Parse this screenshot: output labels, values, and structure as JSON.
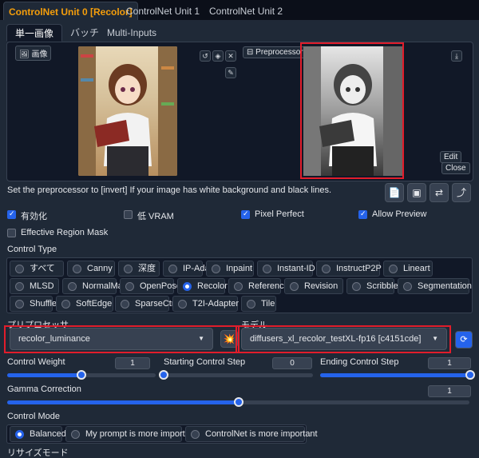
{
  "tabs": [
    "ControlNet Unit 0 [Recolor]",
    "ControlNet Unit 1",
    "ControlNet Unit 2"
  ],
  "subtabs": [
    "単一画像",
    "バッチ",
    "Multi-Inputs"
  ],
  "image_label": "画像",
  "preview_label": "Preprocessor Preview",
  "edit_label": "Edit",
  "close_label": "Close",
  "hint_text": "Set the preprocessor to [invert] If your image has white background and black lines.",
  "checks": {
    "enable": "有効化",
    "lowvram": "低 VRAM",
    "pixel_perfect": "Pixel Perfect",
    "allow_preview": "Allow Preview",
    "region_mask": "Effective Region Mask"
  },
  "control_type_label": "Control Type",
  "control_types": [
    "すべて",
    "Canny",
    "深度",
    "IP-Adapter",
    "Inpaint",
    "Instant-ID",
    "InstructP2P",
    "Lineart",
    "MLSD",
    "NormalMap",
    "OpenPose",
    "Recolor",
    "Reference",
    "Revision",
    "Scribble",
    "Segmentation",
    "Shuffle",
    "SoftEdge",
    "SparseCtrl",
    "T2I-Adapter",
    "Tile"
  ],
  "selected_control_type": "Recolor",
  "preprocessor_label": "プリプロセッサ",
  "preprocessor_value": "recolor_luminance",
  "model_label": "モデル",
  "model_value": "diffusers_xl_recolor_testXL-fp16 [c4151cde]",
  "control_weight_label": "Control Weight",
  "control_weight_value": "1",
  "control_weight": 1,
  "start_step_label": "Starting Control Step",
  "start_step_value": "0",
  "start_step": 0,
  "end_step_label": "Ending Control Step",
  "end_step_value": "1",
  "end_step": 1,
  "gamma_label": "Gamma Correction",
  "gamma_value": "1",
  "gamma": 1,
  "control_mode_label": "Control Mode",
  "control_modes": [
    "Balanced",
    "My prompt is more important",
    "ControlNet is more important"
  ],
  "resize_mode_label": "リサイズモード",
  "colors": {
    "accent": "#2563eb",
    "active_tab": "#f59e0b",
    "highlight": "#e11d2b"
  }
}
